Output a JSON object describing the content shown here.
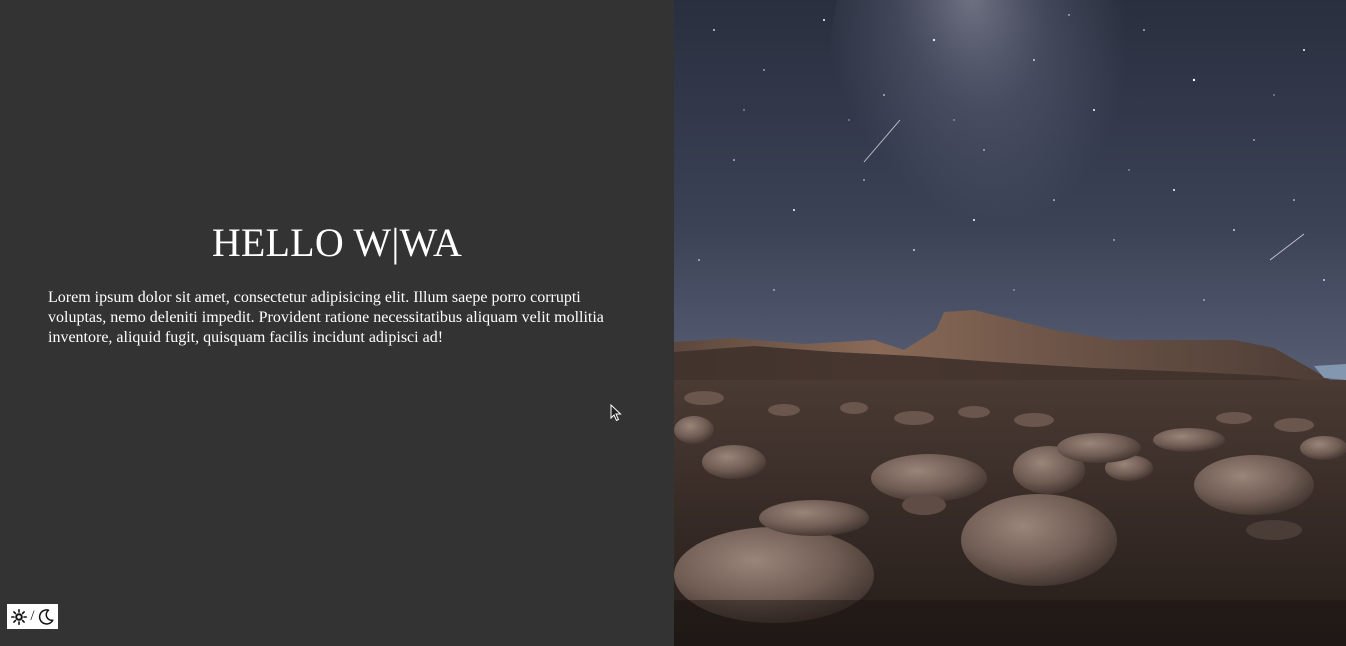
{
  "hero": {
    "title": "HELLO W|WA",
    "body": "Lorem ipsum dolor sit amet, consectetur adipisicing elit. Illum saepe porro corrupti voluptas, nemo deleniti impedit. Provident ratione necessitatibus aliquam velit mollitia inventore, aliquid fugit, quisquam facilis incidunt adipisci ad!"
  },
  "theme_toggle": {
    "separator": "/",
    "light_icon": "sun-icon",
    "dark_icon": "moon-icon"
  },
  "background_image": {
    "subject": "night-sky-desert-landscape-photo"
  },
  "colors": {
    "panel_background": "#333333",
    "text": "#ffffff",
    "toggle_background": "#ffffff"
  }
}
